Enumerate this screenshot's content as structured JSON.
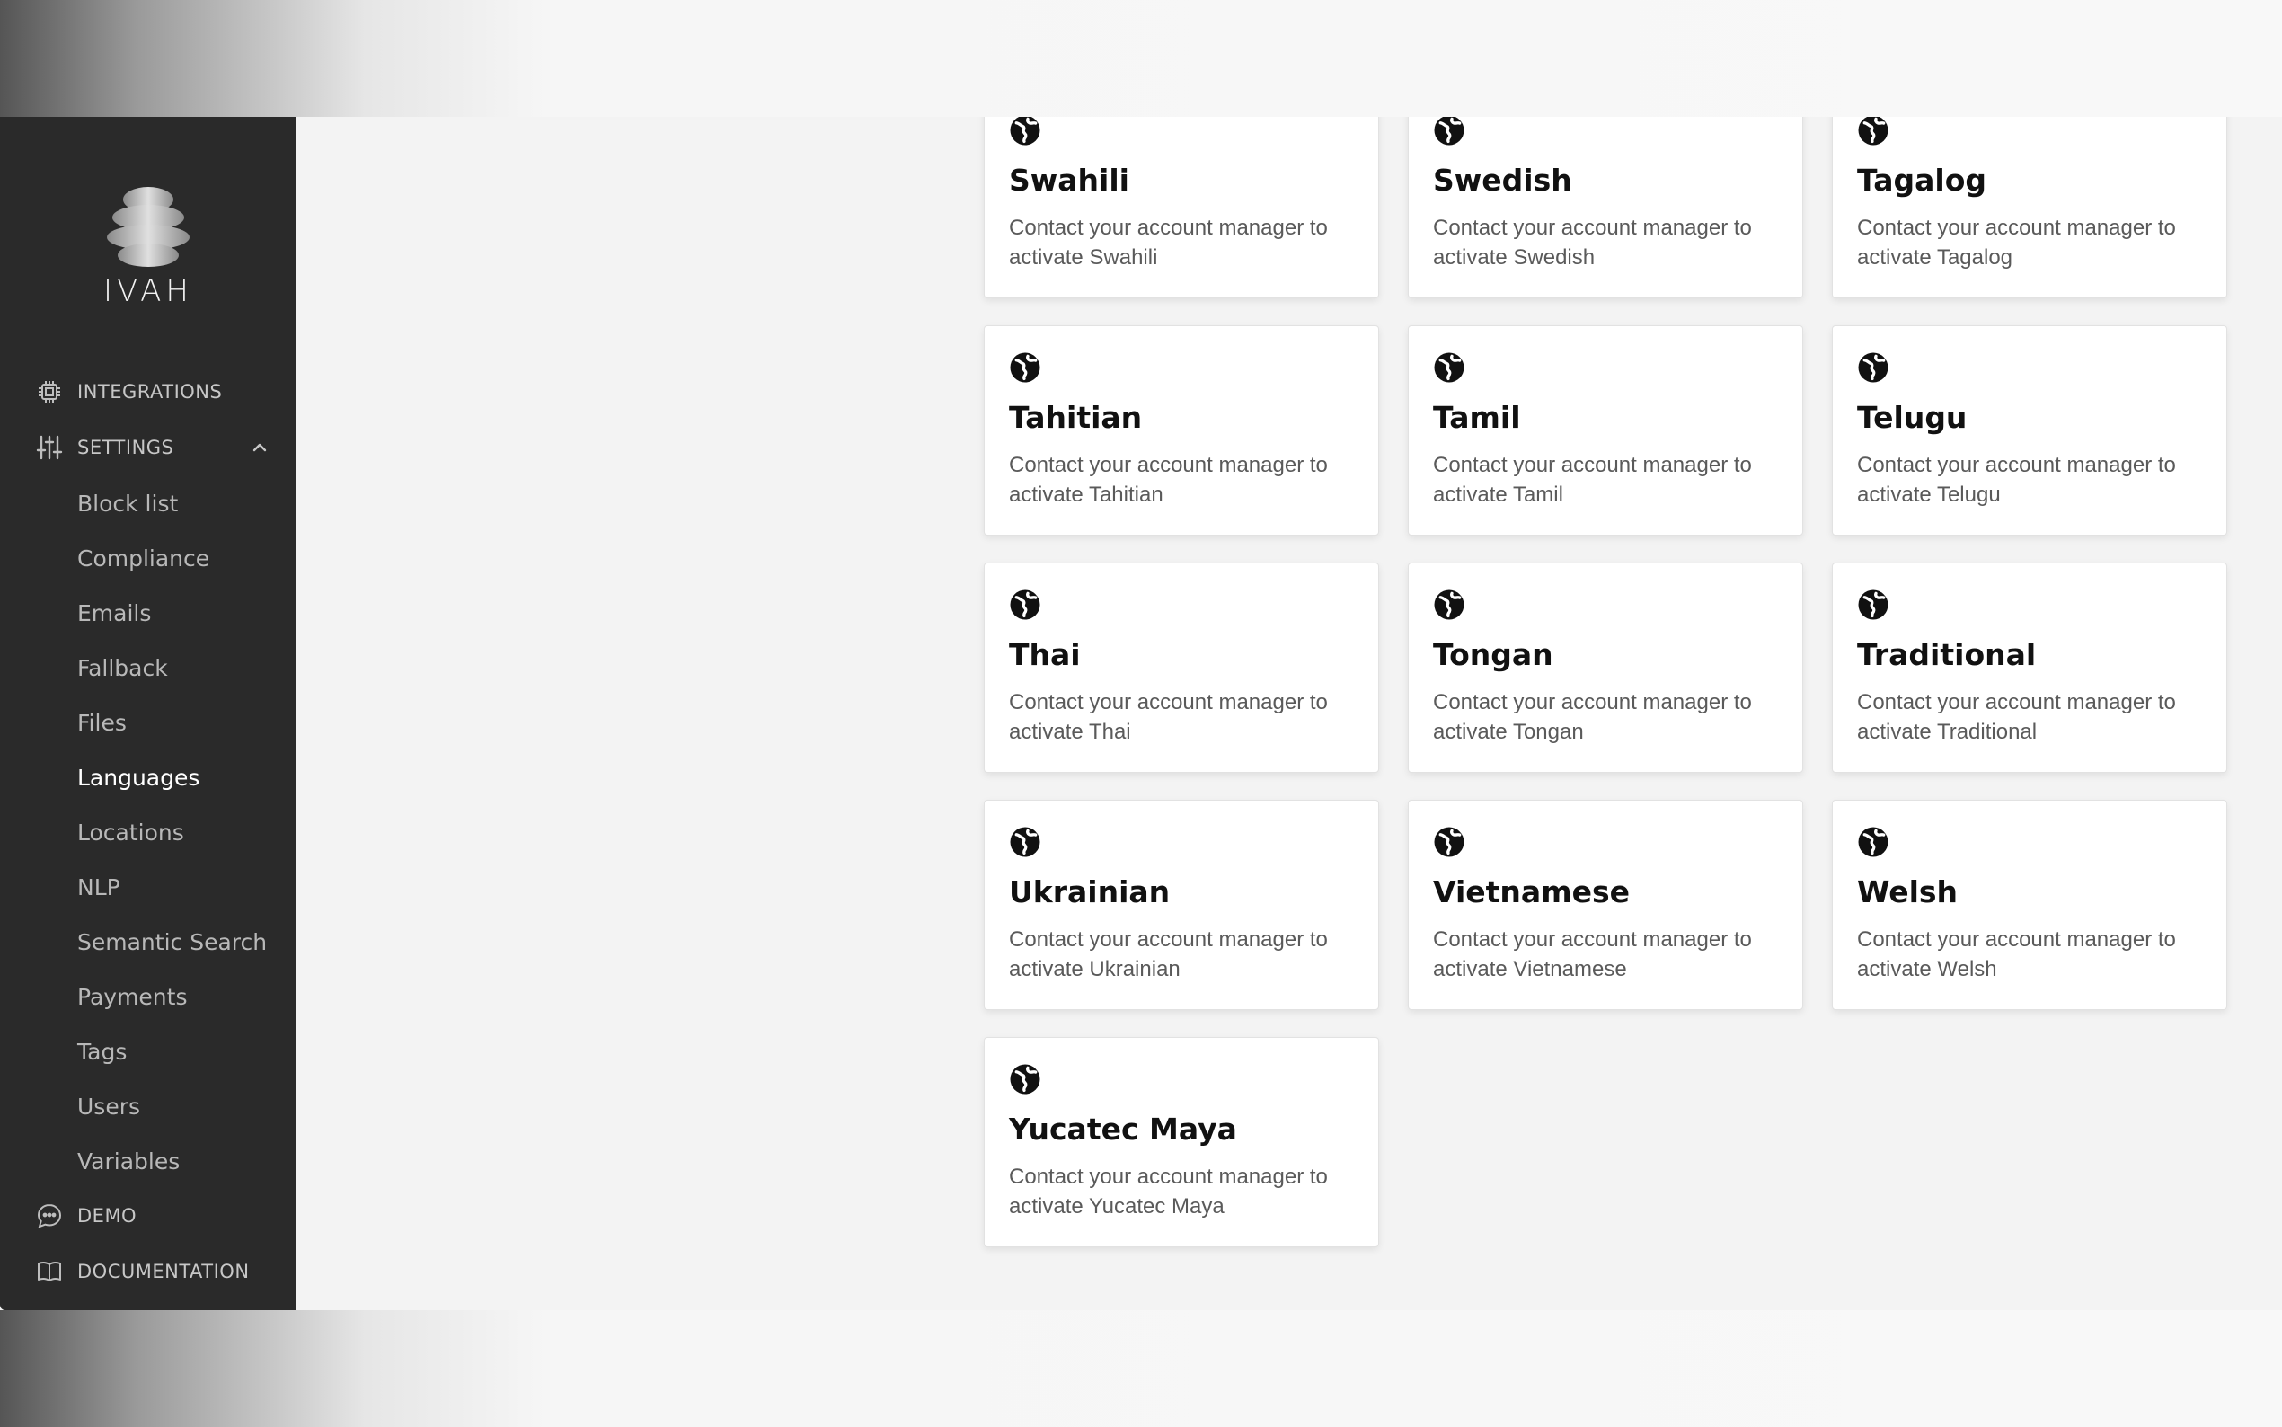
{
  "app": {
    "logo_text": "IVAH"
  },
  "sidebar": {
    "sections": {
      "integrations": "INTEGRATIONS",
      "settings": "SETTINGS",
      "demo": "DEMO",
      "documentation": "DOCUMENTATION"
    },
    "settings_items": [
      {
        "label": "Block list"
      },
      {
        "label": "Compliance"
      },
      {
        "label": "Emails"
      },
      {
        "label": "Fallback"
      },
      {
        "label": "Files"
      },
      {
        "label": "Languages",
        "active": true
      },
      {
        "label": "Locations"
      },
      {
        "label": "NLP"
      },
      {
        "label": "Semantic Search"
      },
      {
        "label": "Payments"
      },
      {
        "label": "Tags"
      },
      {
        "label": "Users"
      },
      {
        "label": "Variables"
      }
    ]
  },
  "languages": [
    {
      "name": "Swahili",
      "description": "Contact your account manager to activate Swahili"
    },
    {
      "name": "Swedish",
      "description": "Contact your account manager to activate Swedish"
    },
    {
      "name": "Tagalog",
      "description": "Contact your account manager to activate Tagalog"
    },
    {
      "name": "Tahitian",
      "description": "Contact your account manager to activate Tahitian"
    },
    {
      "name": "Tamil",
      "description": "Contact your account manager to activate Tamil"
    },
    {
      "name": "Telugu",
      "description": "Contact your account manager to activate Telugu"
    },
    {
      "name": "Thai",
      "description": "Contact your account manager to activate Thai"
    },
    {
      "name": "Tongan",
      "description": "Contact your account manager to activate Tongan"
    },
    {
      "name": "Traditional",
      "description": "Contact your account manager to activate Traditional"
    },
    {
      "name": "Ukrainian",
      "description": "Contact your account manager to activate Ukrainian"
    },
    {
      "name": "Vietnamese",
      "description": "Contact your account manager to activate Vietnamese"
    },
    {
      "name": "Welsh",
      "description": "Contact your account manager to activate Welsh"
    },
    {
      "name": "Yucatec Maya",
      "description": "Contact your account manager to activate Yucatec Maya"
    }
  ],
  "colors": {
    "sidebar_bg": "#2a2a2a",
    "main_bg": "#f3f3f3",
    "card_bg": "#ffffff",
    "active_text": "#ffffff"
  }
}
